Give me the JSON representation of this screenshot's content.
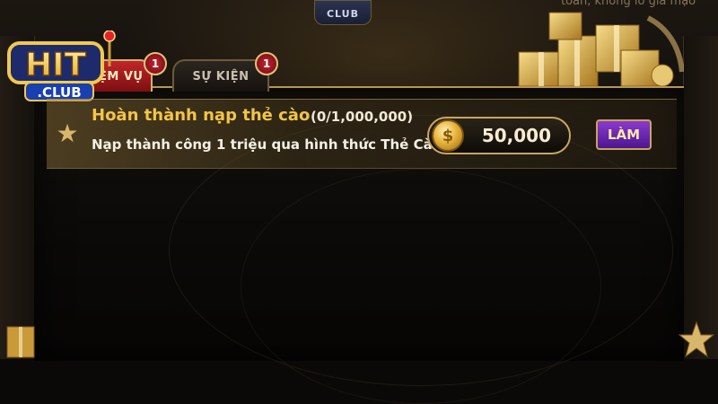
{
  "background": {
    "top_right_text": "toàn, không lo gia mạo",
    "top_logo_text": "CLUB"
  },
  "logo": {
    "main": "HIT",
    "sub": ".CLUB"
  },
  "tabs": [
    {
      "label": "ỆM VỤ",
      "badge": "1",
      "active": true
    },
    {
      "label": "SỰ KIỆN",
      "badge": "1",
      "active": false
    }
  ],
  "task": {
    "title": "Hoàn thành nạp thẻ cào",
    "progress": "(0/1,000,000)",
    "description": "Nạp thành công 1 triệu qua hình thức Thẻ Cào",
    "reward_amount": "50,000",
    "coin_symbol": "$",
    "action_label": "LÀM"
  },
  "icons": {
    "star": "star-icon",
    "coin": "coin-icon"
  },
  "colors": {
    "title_gold": "#f3c544",
    "active_tab": "#c0262a",
    "button_purple": "#7a2fc0",
    "frame_gold": "#c9a560"
  }
}
